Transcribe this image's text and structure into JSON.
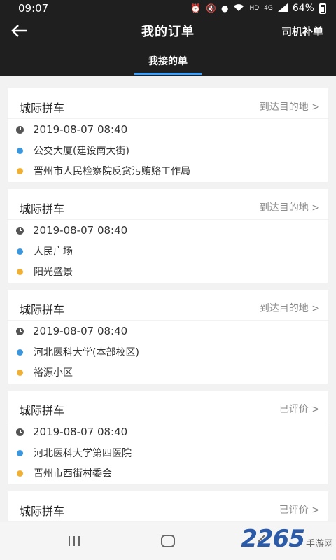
{
  "status_bar": {
    "time": "09:07",
    "network": "HD",
    "signal_text": "4G",
    "battery": "64%",
    "icons": [
      "alarm-icon",
      "mute-icon",
      "location-icon",
      "wifi-icon",
      "signal-icon",
      "battery-icon"
    ]
  },
  "header": {
    "title": "我的订单",
    "right_action": "司机补单",
    "back_icon": "back-arrow-icon"
  },
  "tabs": [
    {
      "label": "我接的单",
      "active": true
    }
  ],
  "orders": [
    {
      "title": "城际拼车",
      "status": "到达目的地 >",
      "time": "2019-08-07 08:40",
      "from": "公交大厦(建设南大街)",
      "to": "晋州市人民检察院反贪污贿赂工作局"
    },
    {
      "title": "城际拼车",
      "status": "到达目的地 >",
      "time": "2019-08-07 08:40",
      "from": "人民广场",
      "to": "阳光盛景"
    },
    {
      "title": "城际拼车",
      "status": "到达目的地 >",
      "time": "2019-08-07 08:40",
      "from": "河北医科大学(本部校区)",
      "to": "裕源小区"
    },
    {
      "title": "城际拼车",
      "status": "已评价 >",
      "time": "2019-08-07 08:40",
      "from": "河北医科大学第四医院",
      "to": "晋州市西街村委会"
    },
    {
      "title": "城际拼车",
      "status": "已评价 >"
    }
  ],
  "watermark": {
    "logo": "2265",
    "text": "手游网"
  },
  "colors": {
    "header_bg": "#1f1f1f",
    "tab_indicator": "#3aa0ff",
    "from_dot": "#3a96dd",
    "to_dot": "#f0b033"
  }
}
